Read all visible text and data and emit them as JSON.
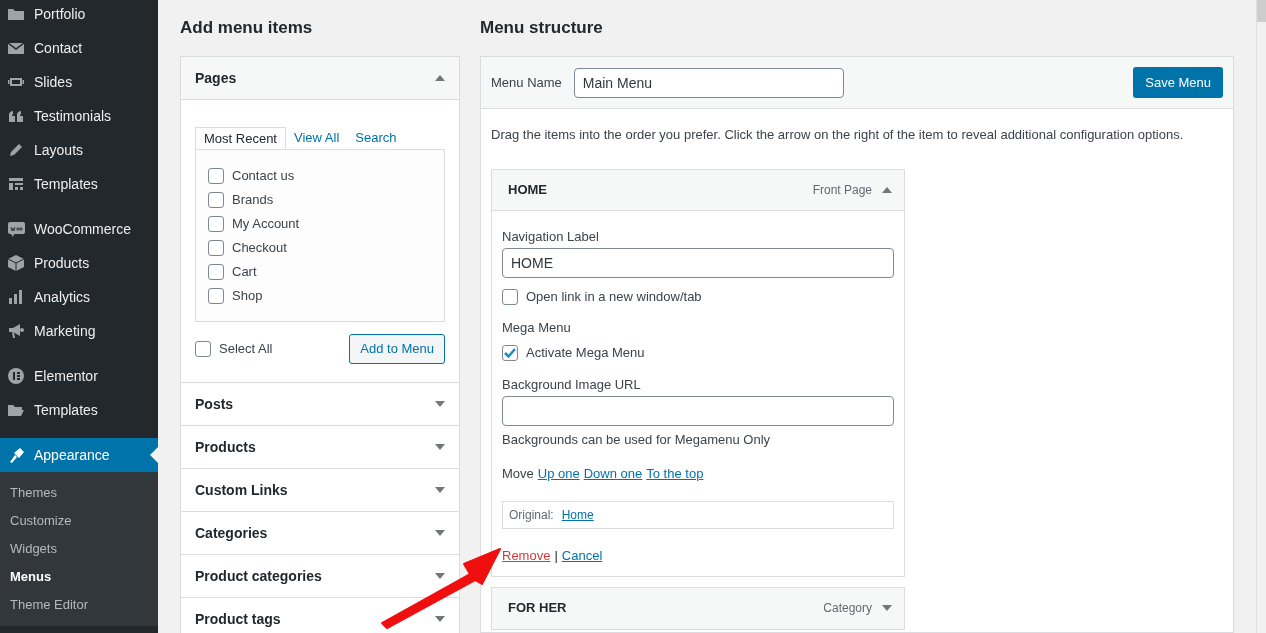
{
  "sidebar": {
    "groups": [
      {
        "items": [
          {
            "label": "Portfolio",
            "selected": false
          },
          {
            "label": "Contact",
            "selected": false
          },
          {
            "label": "Slides",
            "selected": false
          },
          {
            "label": "Testimonials",
            "selected": false
          },
          {
            "label": "Layouts",
            "selected": false
          },
          {
            "label": "Templates",
            "selected": false
          }
        ]
      },
      {
        "items": [
          {
            "label": "WooCommerce",
            "selected": false
          },
          {
            "label": "Products",
            "selected": false
          },
          {
            "label": "Analytics",
            "selected": false
          },
          {
            "label": "Marketing",
            "selected": false
          }
        ]
      },
      {
        "items": [
          {
            "label": "Elementor",
            "selected": false
          },
          {
            "label": "Templates",
            "selected": false
          }
        ]
      },
      {
        "items": [
          {
            "label": "Appearance",
            "selected": true,
            "children": [
              {
                "label": "Themes",
                "selected": false
              },
              {
                "label": "Customize",
                "selected": false
              },
              {
                "label": "Widgets",
                "selected": false
              },
              {
                "label": "Menus",
                "selected": true
              },
              {
                "label": "Theme Editor",
                "selected": false
              }
            ]
          }
        ]
      }
    ]
  },
  "add_menu_items": {
    "title": "Add menu items",
    "sections": [
      {
        "title": "Pages",
        "expanded": true,
        "tabs": [
          {
            "label": "Most Recent",
            "selected": true
          },
          {
            "label": "View All",
            "selected": false
          },
          {
            "label": "Search",
            "selected": false
          }
        ],
        "items": [
          {
            "label": "Contact us",
            "checked": false
          },
          {
            "label": "Brands",
            "checked": false
          },
          {
            "label": "My Account",
            "checked": false
          },
          {
            "label": "Checkout",
            "checked": false
          },
          {
            "label": "Cart",
            "checked": false
          },
          {
            "label": "Shop",
            "checked": false
          }
        ],
        "select_all": {
          "label": "Select All",
          "checked": false
        },
        "button": "Add to Menu"
      },
      {
        "title": "Posts",
        "expanded": false
      },
      {
        "title": "Products",
        "expanded": false
      },
      {
        "title": "Custom Links",
        "expanded": false
      },
      {
        "title": "Categories",
        "expanded": false
      },
      {
        "title": "Product categories",
        "expanded": false
      },
      {
        "title": "Product tags",
        "expanded": false
      }
    ]
  },
  "menu_structure": {
    "title": "Menu structure",
    "menu_name": {
      "label": "Menu Name",
      "value": "Main Menu"
    },
    "save_button": "Save Menu",
    "instructions": "Drag the items into the order you prefer. Click the arrow on the right of the item to reveal additional configuration options.",
    "items": [
      {
        "title": "HOME",
        "type": "Front Page",
        "expanded": true,
        "settings": {
          "navigation_label": {
            "label": "Navigation Label",
            "value": "HOME"
          },
          "open_new_tab": {
            "label": "Open link in a new window/tab",
            "checked": false
          },
          "mega_menu": {
            "label": "Mega Menu",
            "option": {
              "label": "Activate Mega Menu",
              "checked": true
            }
          },
          "background_image": {
            "label": "Background Image URL"
          },
          "note": "Backgrounds can be used for Megamenu Only",
          "move": {
            "label": "Move",
            "links": [
              "Up one",
              "Down one",
              "To the top"
            ]
          },
          "original": {
            "label": "Original:",
            "link": "Home"
          },
          "actions": [
            {
              "label": "Remove",
              "kind": "remove"
            },
            {
              "label": "Cancel",
              "kind": "cancel"
            }
          ],
          "separator": "|"
        }
      },
      {
        "title": "FOR HER",
        "type": "Category",
        "expanded": false
      }
    ]
  }
}
